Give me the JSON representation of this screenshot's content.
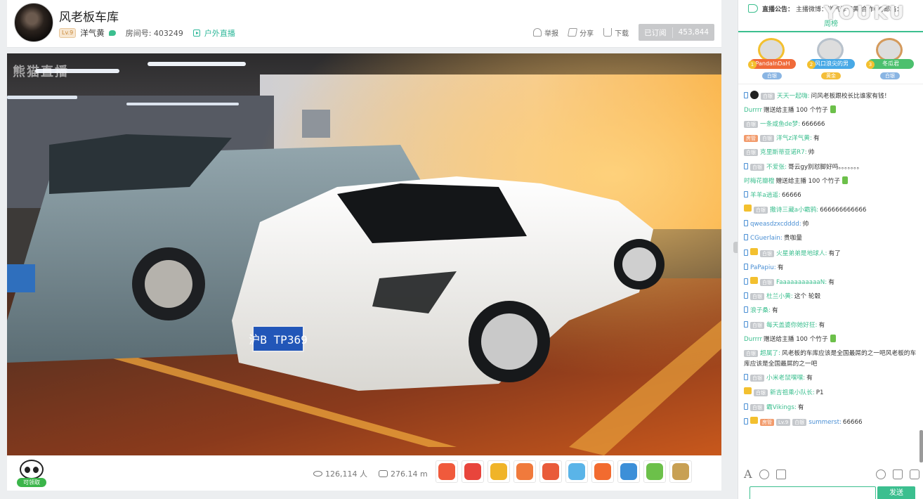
{
  "room": {
    "title": "风老板车库",
    "level": "Lv.9",
    "host": "洋气黄",
    "room_label": "房间号: 403249",
    "category": "户外直播"
  },
  "header_actions": {
    "report": "举报",
    "share": "分享",
    "download": "下载",
    "subscribe_label": "已订阅",
    "subscribe_count": "453,844"
  },
  "video": {
    "watermark": "熊猫直播",
    "plate": "沪B TP369"
  },
  "bottom": {
    "claim_label": "可领取",
    "viewers": "126,114 人",
    "bamboo": "276.14 m",
    "gifts": [
      {
        "icon": "flower-icon",
        "color": "#f05a3c"
      },
      {
        "icon": "crayfish-icon",
        "color": "#e8453c"
      },
      {
        "icon": "stable-icon",
        "color": "#f0b429"
      },
      {
        "icon": "meat-icon",
        "color": "#f07a3c"
      },
      {
        "icon": "leg-icon",
        "color": "#e95b3a"
      },
      {
        "icon": "ghost-icon",
        "color": "#5ab4e8"
      },
      {
        "icon": "666-icon",
        "color": "#f26b2f"
      },
      {
        "icon": "panda-icon",
        "color": "#3c8fd8"
      },
      {
        "icon": "bamboo-tube-icon",
        "color": "#6cc04a"
      },
      {
        "icon": "bag-icon",
        "color": "#c8a053"
      }
    ]
  },
  "announcement": {
    "label": "直播公告：",
    "text": "主播微博：洋气洋气黄 合作QQ邮箱："
  },
  "watermark_brand": "YOUKU",
  "ranking": {
    "tab_active": "周榜",
    "entries": [
      {
        "rank": "1",
        "name": "PandaInDaH",
        "badge": "白银"
      },
      {
        "rank": "2",
        "name": "风口浪尖的男",
        "badge": "黄金"
      },
      {
        "rank": "3",
        "name": "冬瓜君",
        "badge": "白银"
      }
    ]
  },
  "chat": [
    {
      "mobile": true,
      "avatar": true,
      "badges": [
        "白银"
      ],
      "name": "天天一起嗨:",
      "text": "问风老板跟校长比谁家有钱！"
    },
    {
      "mobile": false,
      "badges": [],
      "name": "Durrrr",
      "text": "赠送给主播 100 个竹子",
      "bamboo": true
    },
    {
      "mobile": false,
      "badges": [
        "白银"
      ],
      "name": "一条咸鱼de梦:",
      "text": "666666"
    },
    {
      "mobile": false,
      "badges": [
        "房管",
        "白银"
      ],
      "name": "洋气z洋气黄:",
      "text": "有",
      "badge_style": "or"
    },
    {
      "mobile": false,
      "badges": [
        "白银"
      ],
      "name": "克里斯蒂亚诺R7:",
      "text": "帅"
    },
    {
      "mobile": true,
      "badges": [
        "白银"
      ],
      "name": "不爱张:",
      "text": "哥云gy别怼脚好吗。。。。。。。"
    },
    {
      "mobile": false,
      "badges": [],
      "name": "时梅花瓣橙",
      "text": "赠送给主播 100 个竹子",
      "bamboo": true
    },
    {
      "mobile": true,
      "badges": [],
      "name": "羊羊a逍遥:",
      "text": "66666"
    },
    {
      "mobile": false,
      "crown": true,
      "badges": [
        "白银"
      ],
      "name": "撒诗三藏a小霸鸦:",
      "text": "666666666666"
    },
    {
      "mobile": true,
      "badges": [],
      "name": "qweasdzxcdddd:",
      "text": "帅",
      "name_style": "bl"
    },
    {
      "mobile": true,
      "badges": [],
      "name": "CGuerlain:",
      "text": "贵咖量",
      "name_style": "bl"
    },
    {
      "mobile": true,
      "crown": true,
      "badges": [
        "白银"
      ],
      "name": "火星弟弟是地球人:",
      "text": "有了"
    },
    {
      "mobile": true,
      "badges": [],
      "name": "PaPapiu:",
      "text": "有",
      "name_style": "bl"
    },
    {
      "mobile": true,
      "crown": true,
      "badges": [
        "白银"
      ],
      "name": "FaaaaaaaaaaaN:",
      "text": "有"
    },
    {
      "mobile": true,
      "badges": [
        "白银"
      ],
      "name": "杜兰小黄:",
      "text": "这个 轮毂"
    },
    {
      "mobile": true,
      "badges": [],
      "name": "浪子桑:",
      "text": "有"
    },
    {
      "mobile": true,
      "badges": [
        "白银"
      ],
      "name": "每天盖婆你她好狂:",
      "text": "有"
    },
    {
      "mobile": false,
      "badges": [],
      "name": "Durrrr",
      "text": "赠送给主播 100 个竹子",
      "bamboo": true
    },
    {
      "mobile": false,
      "badges": [
        "白银"
      ],
      "name": "超属了:",
      "text": "风老板的车库应该是全国最屌的之一吧风老板的车库应该是全国最屌的之一吧"
    },
    {
      "mobile": true,
      "badges": [
        "白银"
      ],
      "name": "小米老鼠嘿嘿:",
      "text": "有"
    },
    {
      "mobile": false,
      "crown": true,
      "badges": [
        "白银"
      ],
      "name": "新吉祖乘小队长:",
      "text": "P1"
    },
    {
      "mobile": true,
      "badges": [
        "白银"
      ],
      "name": "霸Vikings:",
      "text": "有"
    },
    {
      "mobile": true,
      "crown": true,
      "badges": [
        "房管",
        "Lv.9",
        "白银"
      ],
      "name": "summerst:",
      "text": "66666",
      "badge_style": "or",
      "name_style": "bl"
    }
  ],
  "chat_input": {
    "send": "发送"
  }
}
